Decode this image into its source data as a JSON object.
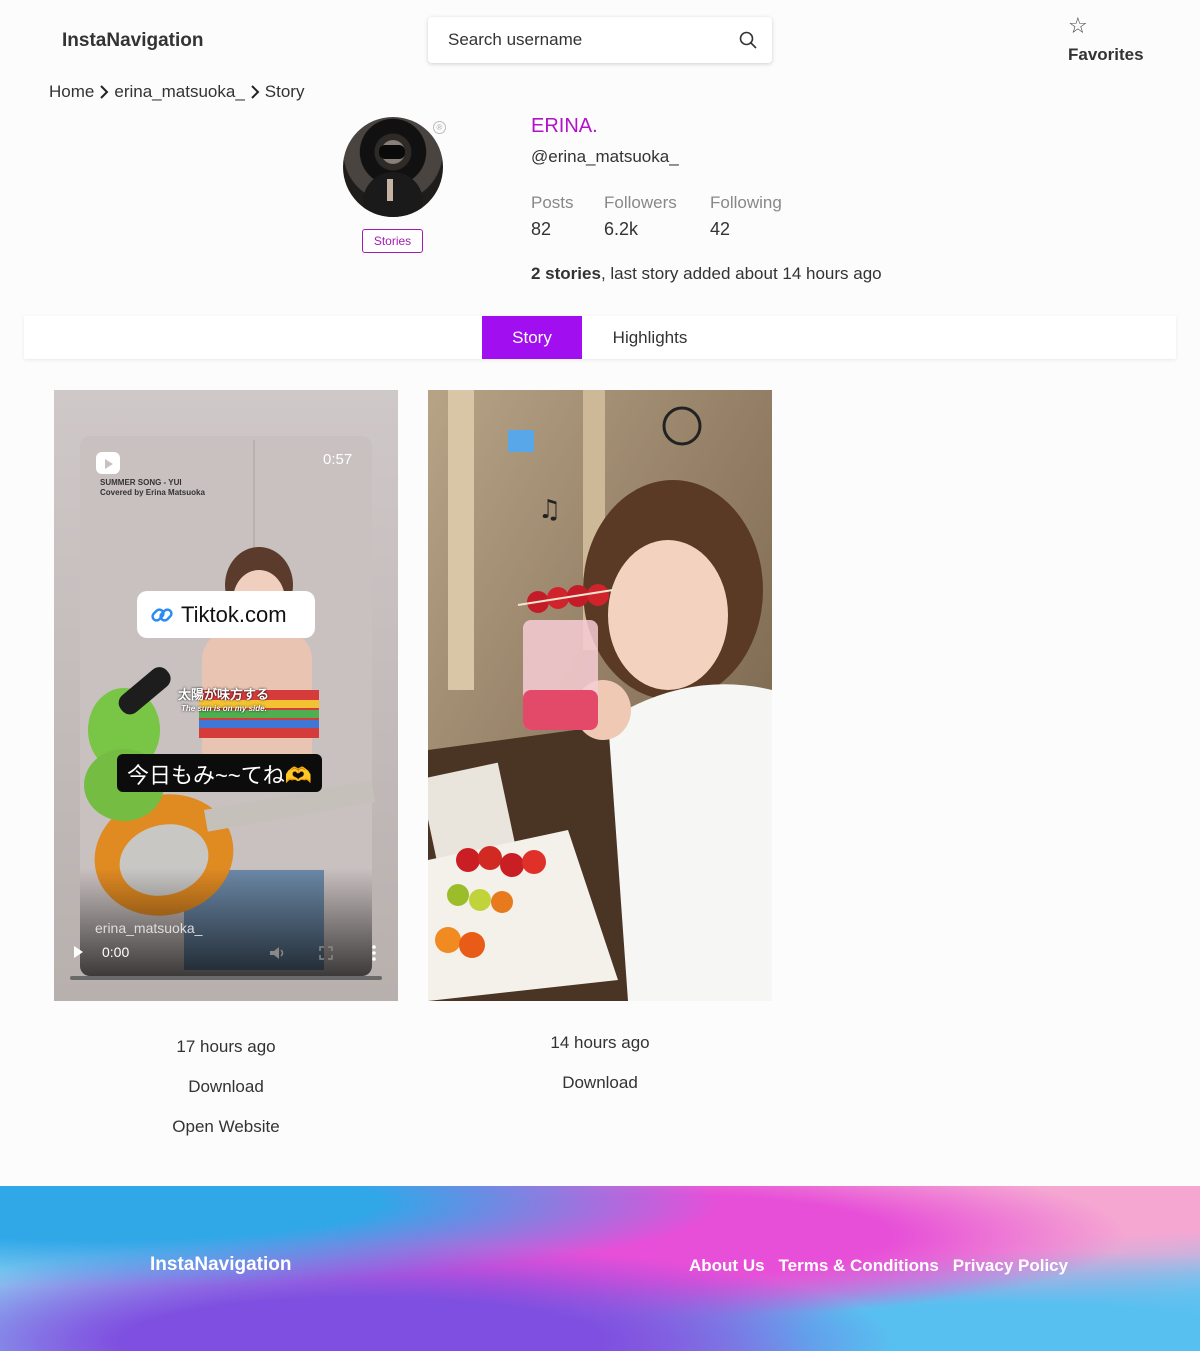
{
  "header": {
    "brand": "InstaNavigation",
    "search_placeholder": "Search username",
    "favorites_label": "Favorites"
  },
  "breadcrumb": [
    "Home",
    "erina_matsuoka_",
    "Story"
  ],
  "profile": {
    "display_name": "ERINA.",
    "handle": "@erina_matsuoka_",
    "stories_badge": "Stories",
    "stats": [
      {
        "label": "Posts",
        "value": "82"
      },
      {
        "label": "Followers",
        "value": "6.2k"
      },
      {
        "label": "Following",
        "value": "42"
      }
    ],
    "stories_count": "2 stories",
    "stories_suffix": ", last story added about 14 hours ago"
  },
  "tabs": [
    "Story",
    "Highlights"
  ],
  "stories": [
    {
      "type": "video",
      "overlay": {
        "duration": "0:57",
        "song": "SUMMER SONG - YUI",
        "cover": "Covered by Erina Matsuoka",
        "link": "Tiktok.com",
        "lyric_jp": "太陽が味方する",
        "lyric_en": "The sun is on my side.",
        "caption": "今日もみ~~てね🫶",
        "username": "erina_matsuoka_",
        "time": "0:00"
      },
      "posted": "17 hours ago",
      "download_label": "Download",
      "open_label": "Open Website"
    },
    {
      "type": "image",
      "posted": "14 hours ago",
      "download_label": "Download"
    }
  ],
  "footer": {
    "brand": "InstaNavigation",
    "links": [
      "About Us",
      "Terms & Conditions",
      "Privacy Policy"
    ]
  },
  "colors": {
    "accent": "#a10ff0",
    "name": "#b212c9"
  }
}
